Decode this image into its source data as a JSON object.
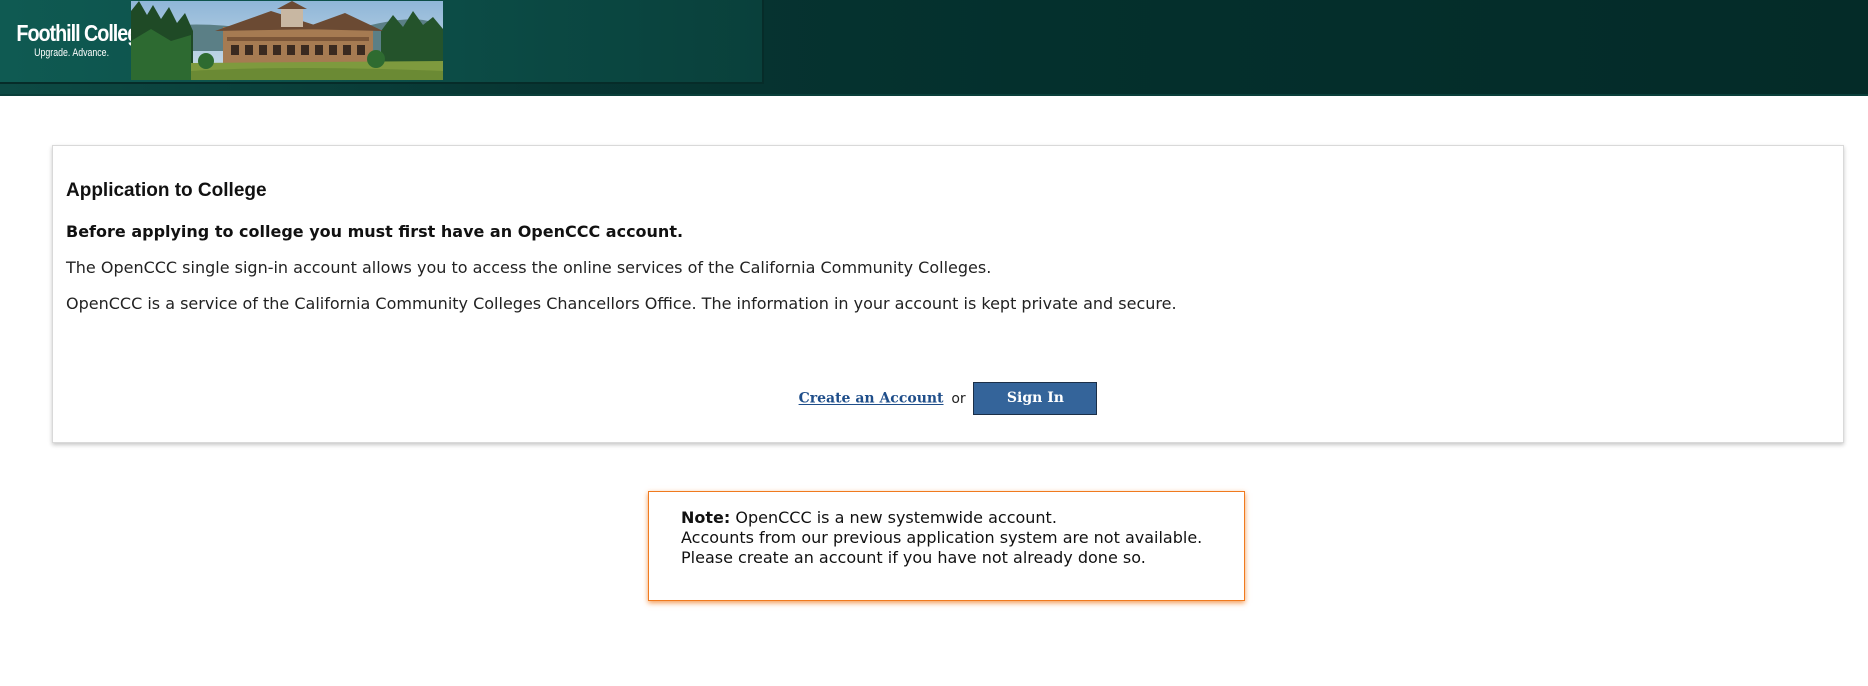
{
  "header": {
    "logo_name": "Foothill College",
    "logo_tagline": "Upgrade. Advance."
  },
  "card": {
    "title": "Application to College",
    "lead": "Before applying to college you must first have an OpenCCC account.",
    "p1": "The OpenCCC single sign-in account allows you to access the online services of the California Community Colleges.",
    "p2": "OpenCCC is a service of the California Community Colleges Chancellors Office. The information in your account is kept private and secure.",
    "create_link": "Create an Account",
    "or": "or",
    "signin": "Sign In"
  },
  "note": {
    "label": "Note:",
    "line1": "OpenCCC is a new systemwide account.",
    "line2": "Accounts from our previous application system are not available.",
    "line3": "Please create an account if you have not already done so."
  },
  "colors": {
    "header_bg": "#04302d",
    "button_bg": "#34649a",
    "link": "#1f4e8a",
    "note_border": "#f07a1e"
  }
}
